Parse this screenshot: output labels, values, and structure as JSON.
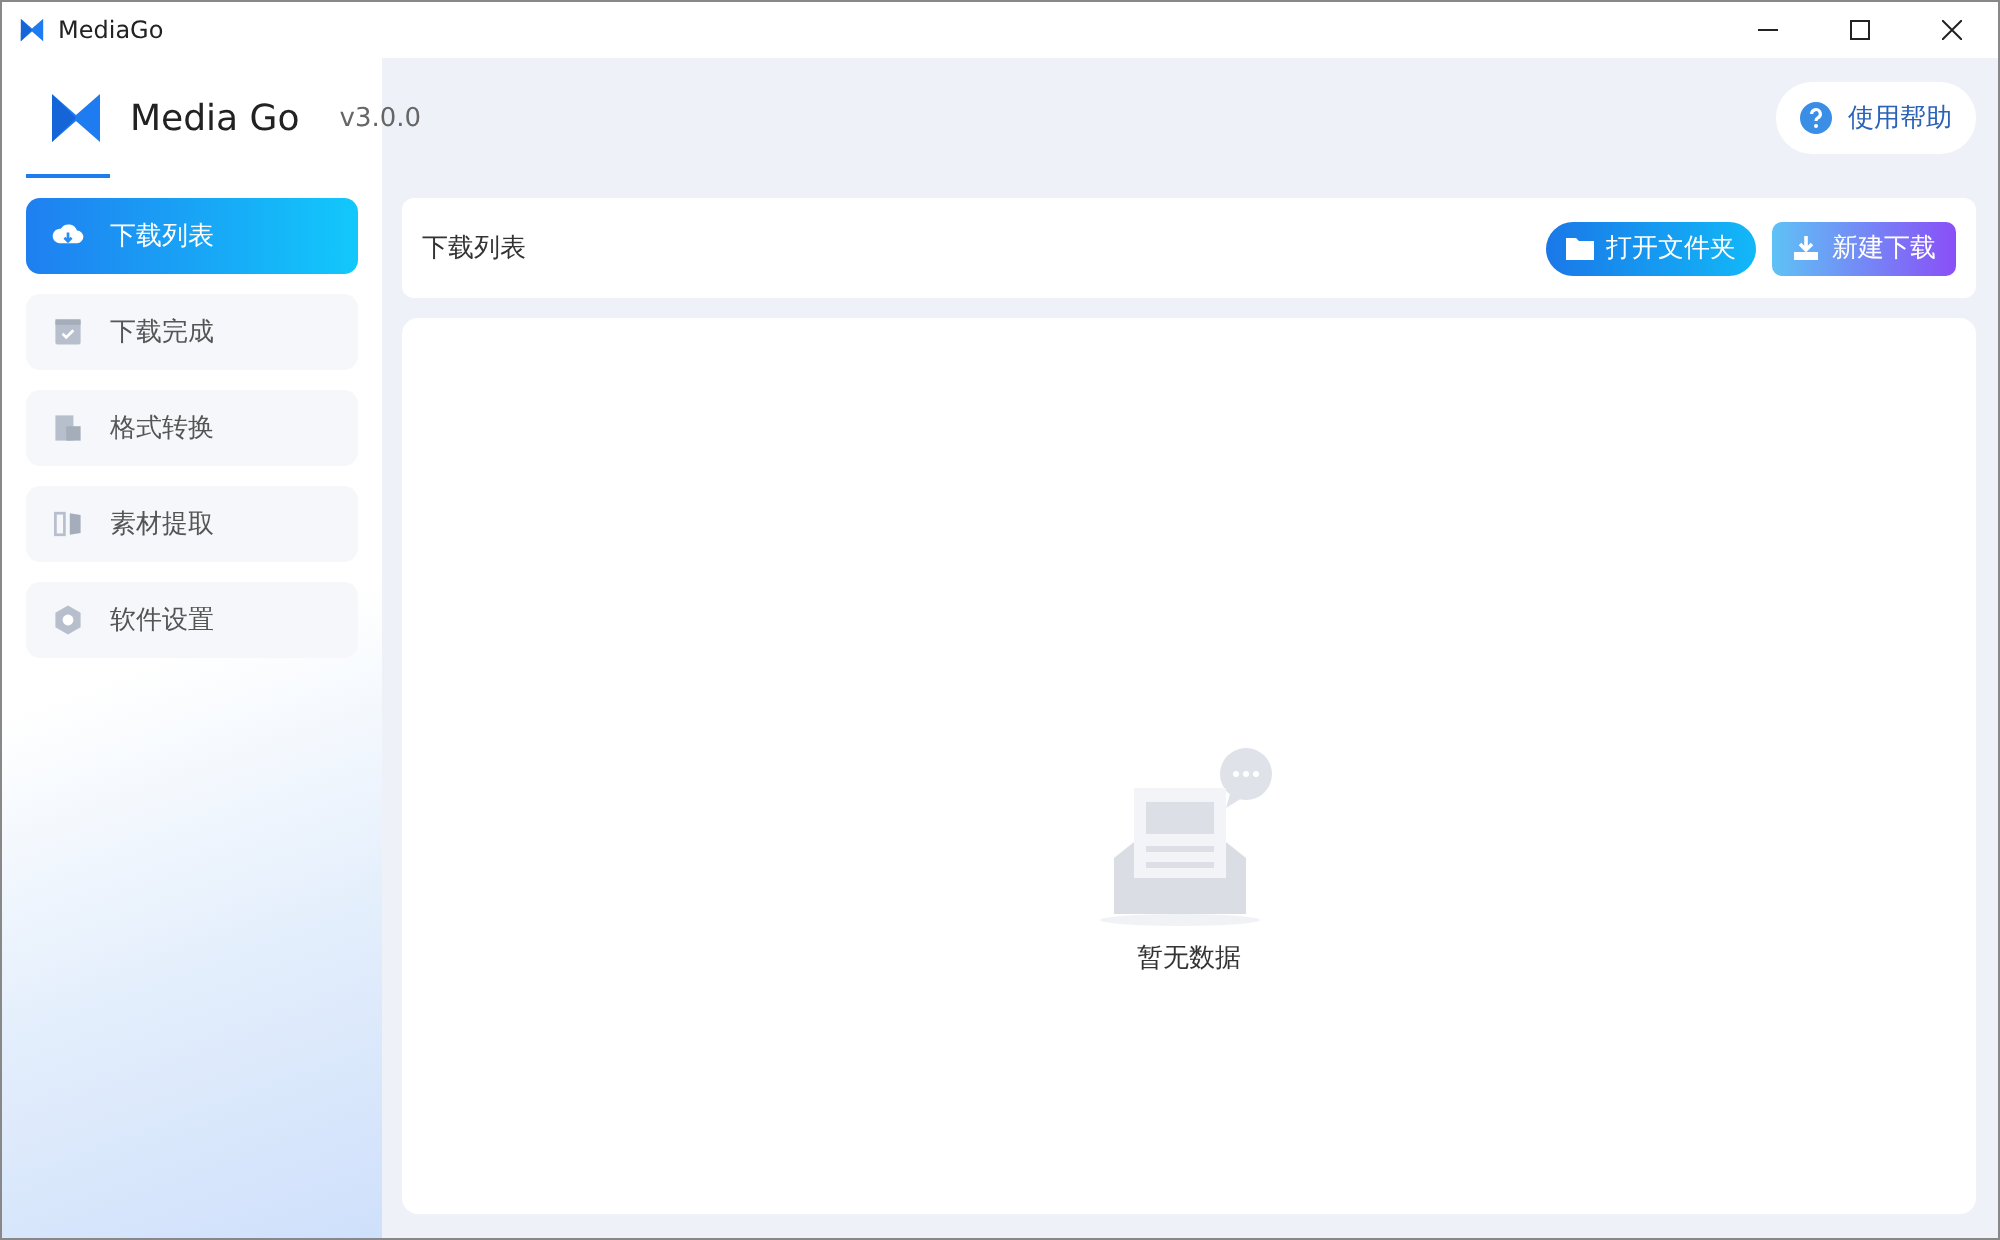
{
  "window": {
    "title": "MediaGo"
  },
  "header": {
    "app_name": "Media Go",
    "version": "v3.0.0",
    "help": "使用帮助"
  },
  "sidebar": {
    "items": [
      {
        "label": "下载列表",
        "selected": true
      },
      {
        "label": "下载完成",
        "selected": false
      },
      {
        "label": "格式转换",
        "selected": false
      },
      {
        "label": "素材提取",
        "selected": false
      },
      {
        "label": "软件设置",
        "selected": false
      }
    ]
  },
  "toolbar": {
    "title": "下载列表",
    "buttons": [
      {
        "label": "打开文件夹",
        "kind": "folder"
      },
      {
        "label": "新建下载",
        "kind": "download"
      }
    ]
  },
  "content": {
    "empty_text": "暂无数据"
  }
}
